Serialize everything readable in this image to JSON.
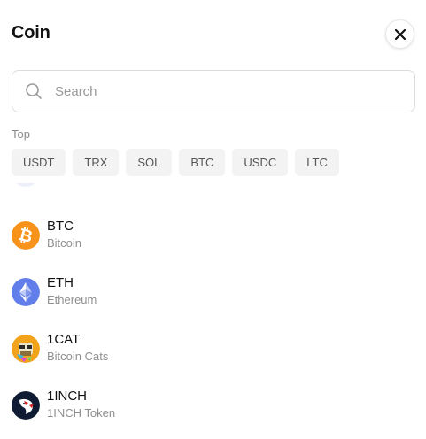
{
  "header": {
    "title": "Coin"
  },
  "search": {
    "placeholder": "Search",
    "value": ""
  },
  "top": {
    "label": "Top",
    "chips": [
      "USDT",
      "TRX",
      "SOL",
      "BTC",
      "USDC",
      "LTC"
    ]
  },
  "list": {
    "coins": [
      {
        "symbol": "BTC",
        "name": "Bitcoin",
        "icon": "bitcoin-icon",
        "color": "#F7931A"
      },
      {
        "symbol": "ETH",
        "name": "Ethereum",
        "icon": "ethereum-icon",
        "color": "#627EEA"
      },
      {
        "symbol": "1CAT",
        "name": "Bitcoin Cats",
        "icon": "bitcoin-cats-icon",
        "color": "#F2A31B"
      },
      {
        "symbol": "1INCH",
        "name": "1INCH Token",
        "icon": "1inch-icon",
        "color": "#0F1B33"
      }
    ]
  }
}
